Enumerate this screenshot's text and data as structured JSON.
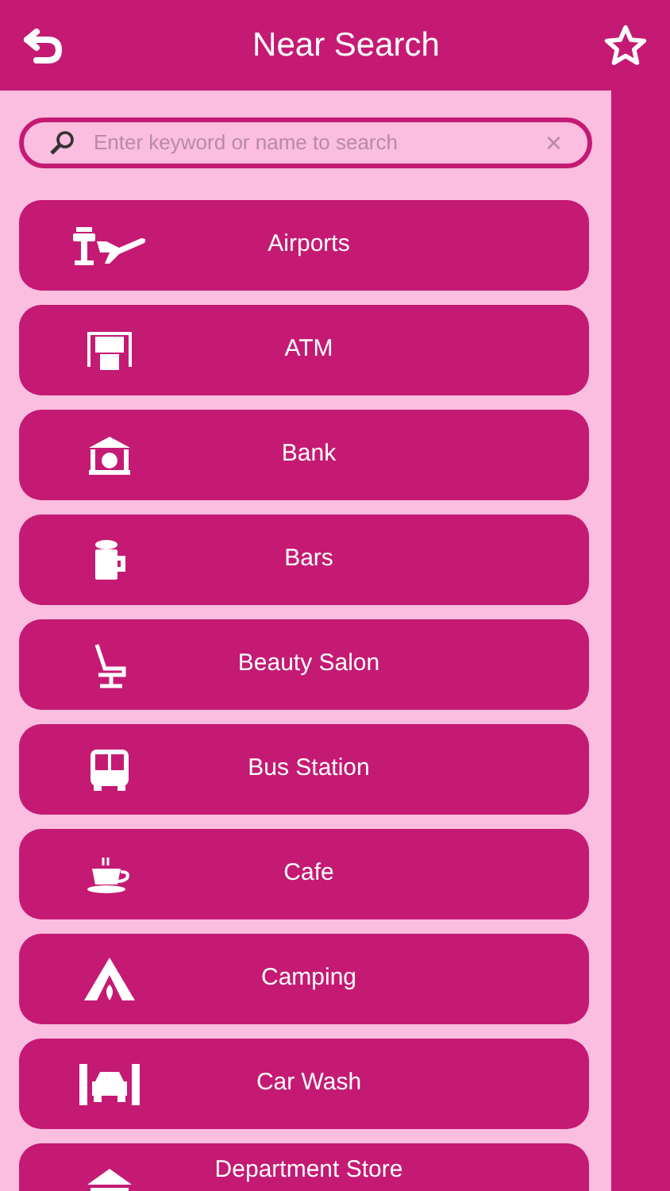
{
  "header": {
    "title": "Near Search"
  },
  "search": {
    "placeholder": "Enter keyword or name to search",
    "clear": "×"
  },
  "categories": [
    {
      "label": "Airports"
    },
    {
      "label": "ATM"
    },
    {
      "label": "Bank"
    },
    {
      "label": "Bars"
    },
    {
      "label": "Beauty Salon"
    },
    {
      "label": "Bus Station"
    },
    {
      "label": "Cafe"
    },
    {
      "label": "Camping"
    },
    {
      "label": "Car Wash"
    },
    {
      "label": "Department Store"
    }
  ]
}
